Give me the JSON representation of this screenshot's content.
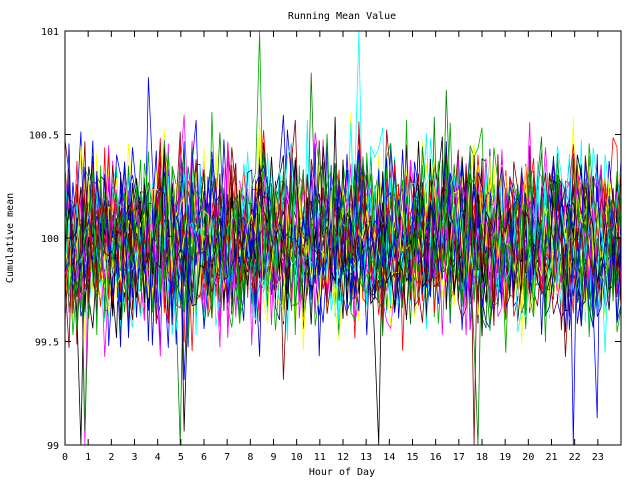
{
  "chart_data": {
    "type": "line",
    "title": "Running Mean Value",
    "xlabel": "Hour of Day",
    "ylabel": "Cumulative mean",
    "xlim": [
      0,
      24
    ],
    "ylim": [
      99,
      101
    ],
    "x_ticks": [
      "0",
      "1",
      "2",
      "3",
      "4",
      "5",
      "6",
      "7",
      "8",
      "9",
      "10",
      "11",
      "12",
      "13",
      "14",
      "15",
      "16",
      "17",
      "18",
      "19",
      "20",
      "21",
      "22",
      "23"
    ],
    "y_ticks": [
      "99",
      "99.5",
      "100",
      "100.5",
      "101"
    ],
    "grid": false,
    "legend": "none",
    "series_count": 40,
    "series_colors": [
      "#ff0000",
      "#008000",
      "#0000ff",
      "#ff00ff",
      "#00ffff",
      "#ffff00",
      "#000000",
      "#800000",
      "#0000cc",
      "#00aa00"
    ],
    "center_value": 100.0,
    "typical_range": [
      99.3,
      100.8
    ]
  }
}
